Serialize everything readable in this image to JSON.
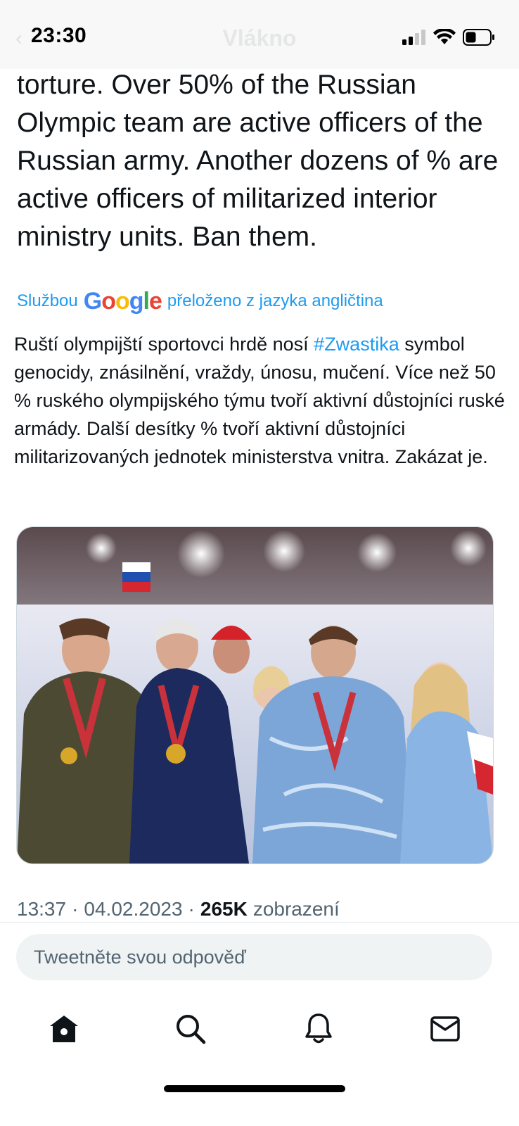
{
  "status_bar": {
    "time": "23:30"
  },
  "header": {
    "title": "Vlákno",
    "back_glyph": "‹"
  },
  "tweet": {
    "original_text": "torture. Over 50% of the Russian Olympic team are active officers of the Russian army. Another dozens of % are active officers of militarized interior ministry units. Ban them.",
    "translation": {
      "prefix": "Službou",
      "google": "Google",
      "suffix": "přeloženo z jazyka angličtina"
    },
    "translated_before_hashtag": "Ruští olympijští sportovci hrdě nosí ",
    "hashtag": "#Zwastika",
    "translated_after_hashtag": " symbol genocidy, znásilnění, vraždy, únosu, mučení. Více než 50 % ruského olympijského týmu tvoří aktivní důstojníci ruské armády. Další desítky % tvoří aktivní důstojníci militarizovaných jednotek ministerstva vnitra. Zakázat je.",
    "meta": {
      "time": "13:37",
      "separator": "·",
      "date": "04.02.2023",
      "views_count": "265K",
      "views_label": "zobrazení"
    }
  },
  "reply": {
    "placeholder": "Tweetněte svou odpověď"
  },
  "tabbar": {
    "items": [
      {
        "icon": "home-icon"
      },
      {
        "icon": "search-icon"
      },
      {
        "icon": "bell-icon"
      },
      {
        "icon": "mail-icon"
      }
    ]
  },
  "colors": {
    "link": "#1d9bf0",
    "text": "#0f1419",
    "muted": "#536471"
  }
}
